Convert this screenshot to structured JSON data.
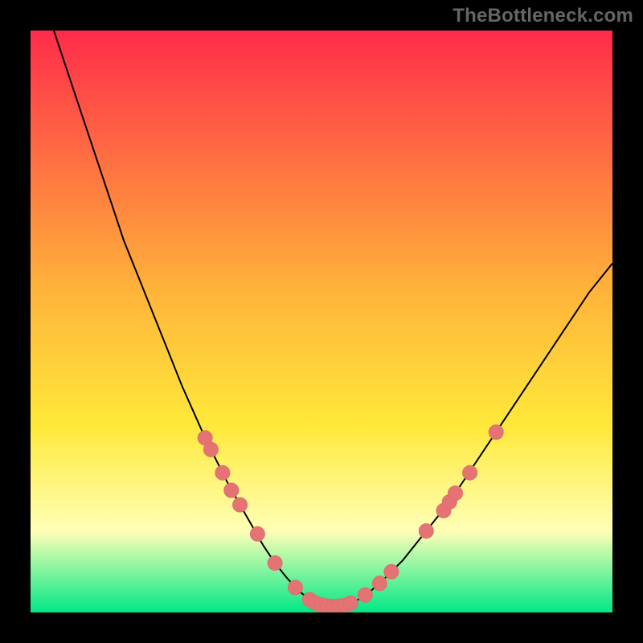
{
  "watermark": "TheBottleneck.com",
  "colors": {
    "bg": "#000000",
    "grad_top": "#ff2c4a",
    "grad_mid1": "#ffb43a",
    "grad_mid2": "#ffe93a",
    "grad_mid3": "#ffffb6",
    "grad_bot": "#00e887",
    "curve": "#000000",
    "marker_fill": "#e57373",
    "marker_stroke": "#db6e6e"
  },
  "chart_data": {
    "type": "line",
    "title": "",
    "xlabel": "",
    "ylabel": "",
    "xlim": [
      0,
      100
    ],
    "ylim": [
      0,
      100
    ],
    "series": [
      {
        "name": "curve",
        "x": [
          4,
          6,
          8,
          10,
          12,
          14,
          16,
          18,
          20,
          22,
          24,
          26,
          28,
          30,
          32,
          34,
          36,
          38,
          40,
          42,
          44,
          46,
          48,
          50,
          52,
          54,
          56,
          58,
          60,
          64,
          68,
          72,
          76,
          80,
          84,
          88,
          92,
          96,
          100
        ],
        "y": [
          100,
          94,
          88,
          82,
          76,
          70,
          64,
          59,
          54,
          49,
          44,
          39,
          34.5,
          30,
          26,
          22,
          18.5,
          15,
          11.5,
          8.5,
          6,
          3.8,
          2.2,
          1.3,
          1,
          1.2,
          2,
          3.3,
          5,
          9,
          14,
          19,
          25,
          31,
          37,
          43,
          49,
          55,
          60
        ]
      }
    ],
    "markers": [
      {
        "x": 30,
        "y": 30
      },
      {
        "x": 31,
        "y": 28
      },
      {
        "x": 33,
        "y": 24
      },
      {
        "x": 34.5,
        "y": 21
      },
      {
        "x": 36,
        "y": 18.5
      },
      {
        "x": 39,
        "y": 13.5
      },
      {
        "x": 42,
        "y": 8.5
      },
      {
        "x": 45.5,
        "y": 4.3
      },
      {
        "x": 48,
        "y": 2.2
      },
      {
        "x": 49,
        "y": 1.6
      },
      {
        "x": 50,
        "y": 1.3
      },
      {
        "x": 51,
        "y": 1.1
      },
      {
        "x": 52,
        "y": 1
      },
      {
        "x": 53,
        "y": 1.1
      },
      {
        "x": 54,
        "y": 1.2
      },
      {
        "x": 55,
        "y": 1.6
      },
      {
        "x": 57.5,
        "y": 3
      },
      {
        "x": 60,
        "y": 5
      },
      {
        "x": 62,
        "y": 7
      },
      {
        "x": 68,
        "y": 14
      },
      {
        "x": 71,
        "y": 17.5
      },
      {
        "x": 72,
        "y": 19
      },
      {
        "x": 73,
        "y": 20.5
      },
      {
        "x": 75.5,
        "y": 24
      },
      {
        "x": 80,
        "y": 31
      }
    ]
  }
}
